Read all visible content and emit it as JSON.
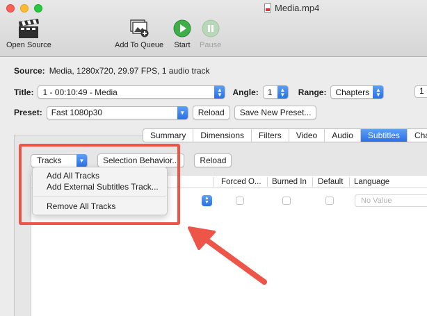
{
  "window": {
    "title": "Media.mp4"
  },
  "toolbar": {
    "open_source": "Open Source",
    "add_to_queue": "Add To Queue",
    "start": "Start",
    "pause": "Pause"
  },
  "source": {
    "label": "Source:",
    "value": "Media, 1280x720, 29.97 FPS, 1 audio track"
  },
  "title": {
    "label": "Title:",
    "value": "1 - 00:10:49 - Media"
  },
  "angle": {
    "label": "Angle:",
    "value": "1"
  },
  "range": {
    "label": "Range:",
    "value": "Chapters",
    "start": "1"
  },
  "preset": {
    "label": "Preset:",
    "value": "Fast 1080p30",
    "reload": "Reload",
    "save_new": "Save New Preset..."
  },
  "tabs": [
    "Summary",
    "Dimensions",
    "Filters",
    "Video",
    "Audio",
    "Subtitles",
    "Chap"
  ],
  "active_tab": "Subtitles",
  "subtitles": {
    "tracks_button": "Tracks",
    "selection_behavior": "Selection Behavior...",
    "reload": "Reload",
    "columns": {
      "forced": "Forced O...",
      "burned": "Burned In",
      "default": "Default",
      "language": "Language"
    },
    "language_placeholder": "No Value"
  },
  "tracks_menu": {
    "items": [
      "Add All Tracks",
      "Add External Subtitles Track...",
      "Remove All Tracks"
    ]
  },
  "colors": {
    "accent": "#2b6fe3",
    "annotation": "#ee5549"
  }
}
